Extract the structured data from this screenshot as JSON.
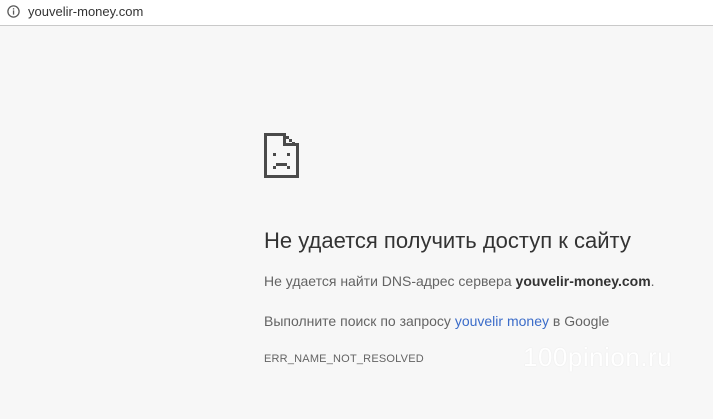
{
  "address_bar": {
    "icon": "info-icon",
    "url": "youvelir-money.com"
  },
  "error": {
    "icon": "sad-document-icon",
    "title": "Не удается получить доступ к сайту",
    "dns_prefix": "Не удается найти DNS-адрес сервера ",
    "dns_domain": "youvelir-money.com",
    "dns_suffix": ".",
    "search_prefix": "Выполните поиск по запросу ",
    "search_query": "youvelir money",
    "search_suffix": " в Google",
    "code": "ERR_NAME_NOT_RESOLVED"
  },
  "watermark": "100pinion.ru",
  "colors": {
    "background": "#f7f7f7",
    "title": "#333333",
    "body_text": "#646464",
    "link": "#3b6cc9"
  }
}
